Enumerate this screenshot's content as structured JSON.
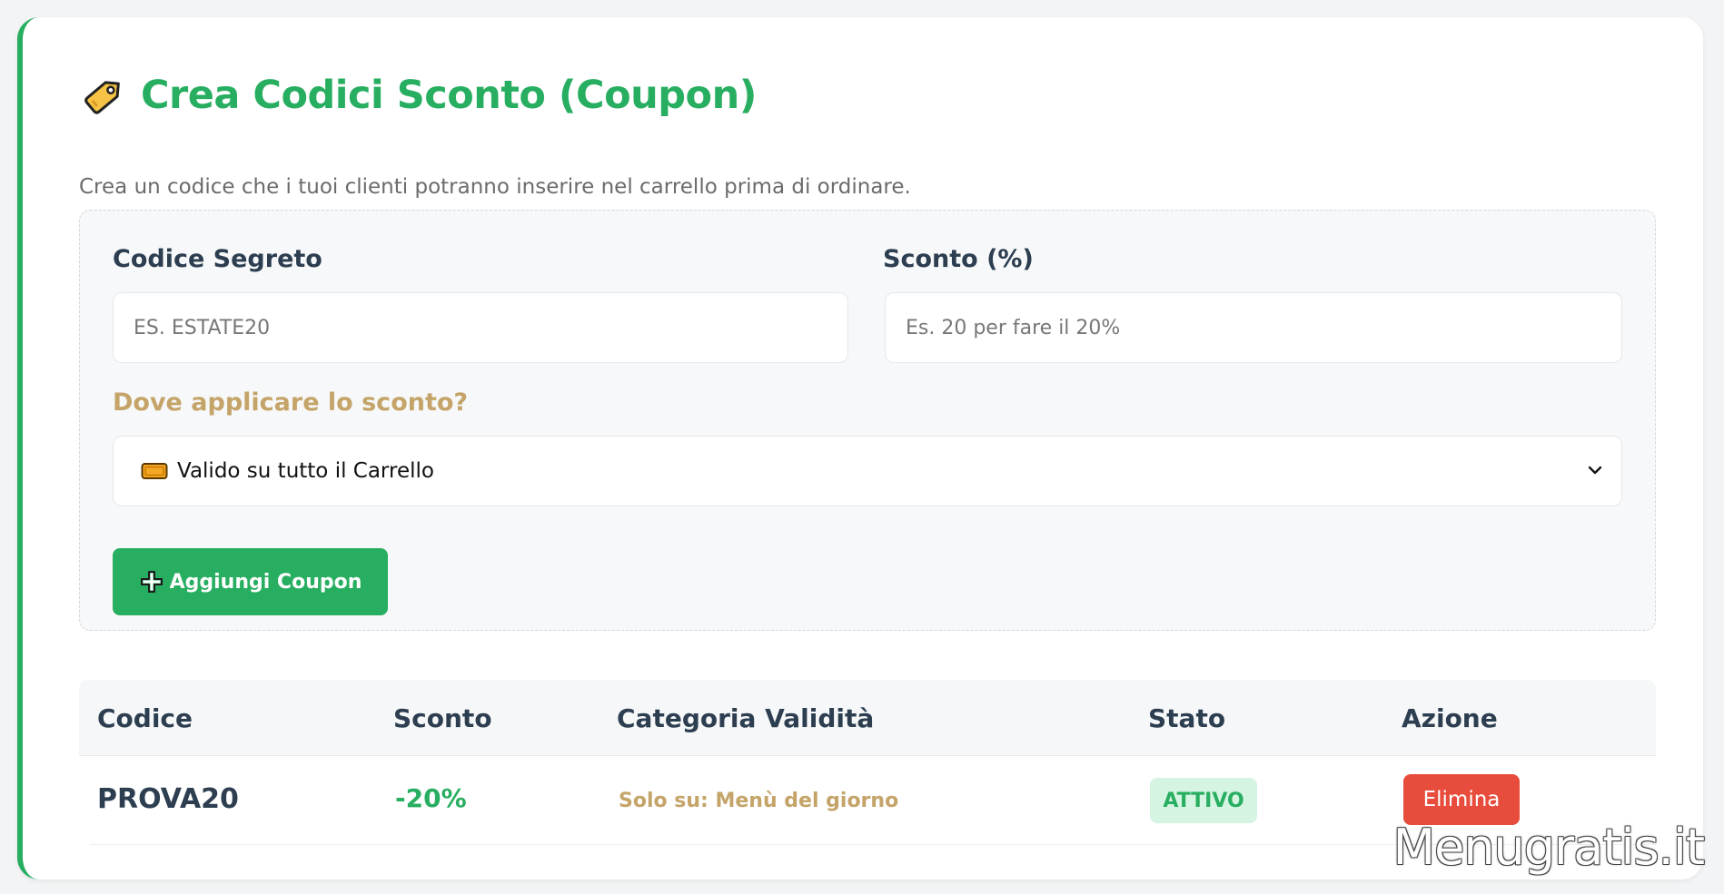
{
  "header": {
    "title": "Crea Codici Sconto (Coupon)",
    "title_icon": "tag-icon",
    "subtitle": "Crea un codice che i tuoi clienti potranno inserire nel carrello prima di ordinare."
  },
  "form": {
    "code_label": "Codice Segreto",
    "code_placeholder": "ES. ESTATE20",
    "discount_label": "Sconto (%)",
    "discount_placeholder": "Es. 20 per fare il 20%",
    "scope_label": "Dove applicare lo sconto?",
    "scope_selected": "Valido su tutto il Carrello",
    "scope_icon": "ticket-icon",
    "add_button_label": "Aggiungi Coupon",
    "add_button_icon": "plus-icon"
  },
  "table": {
    "headers": [
      "Codice",
      "Sconto",
      "Categoria Validità",
      "Stato",
      "Azione"
    ],
    "rows": [
      {
        "code": "PROVA20",
        "discount": "-20%",
        "category": "Solo su: Menù del giorno",
        "status": "ATTIVO",
        "action": "Elimina"
      }
    ]
  },
  "watermark": "Menugratis.it",
  "colors": {
    "accent": "#27ae60",
    "gold": "#c4a468",
    "danger": "#e74c3c",
    "heading": "#2c3e50"
  }
}
